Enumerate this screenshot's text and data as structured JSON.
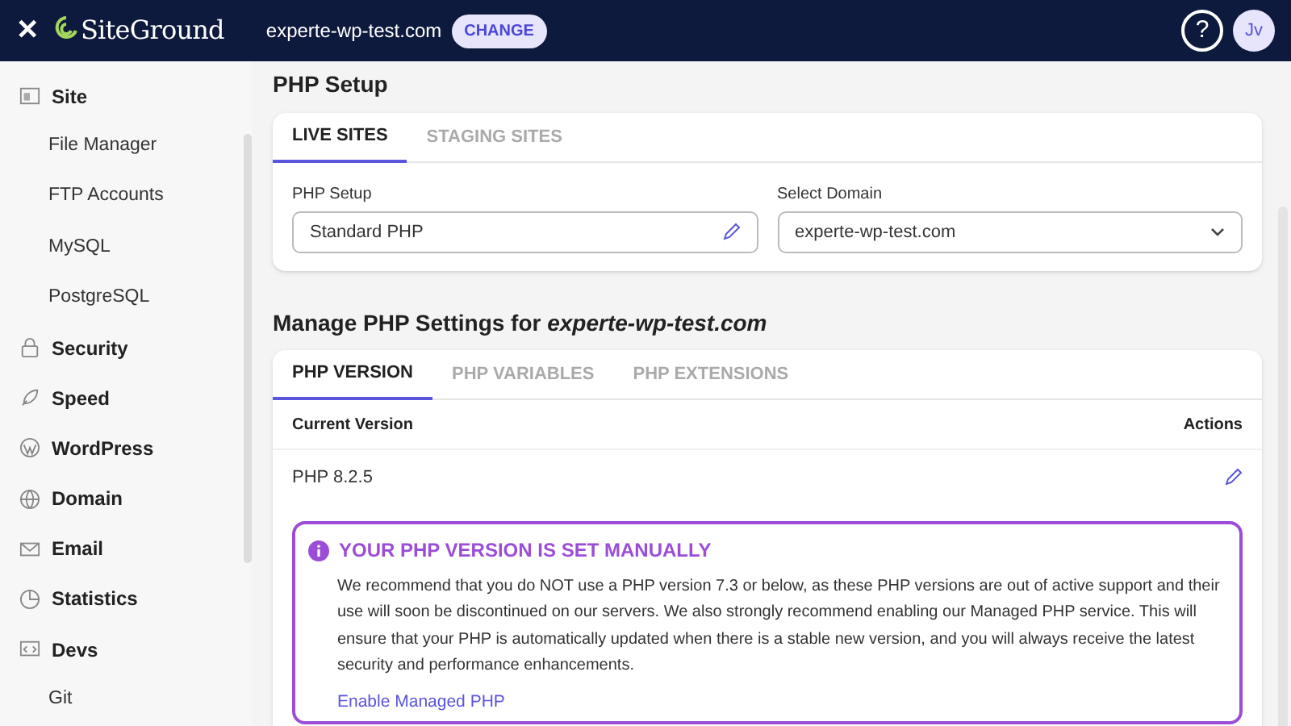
{
  "header": {
    "close": "✕",
    "logo": "SiteGround",
    "site": "experte-wp-test.com",
    "change_button": "CHANGE",
    "help": "?",
    "avatar": "Jv"
  },
  "sidebar": {
    "items": [
      {
        "kind": "section",
        "label": "Site"
      },
      {
        "kind": "sub",
        "label": "File Manager"
      },
      {
        "kind": "sub",
        "label": "FTP Accounts"
      },
      {
        "kind": "sub",
        "label": "MySQL"
      },
      {
        "kind": "sub",
        "label": "PostgreSQL"
      },
      {
        "kind": "section",
        "label": "Security"
      },
      {
        "kind": "section",
        "label": "Speed"
      },
      {
        "kind": "section",
        "label": "WordPress"
      },
      {
        "kind": "section",
        "label": "Domain"
      },
      {
        "kind": "section",
        "label": "Email"
      },
      {
        "kind": "section",
        "label": "Statistics"
      },
      {
        "kind": "section",
        "label": "Devs"
      },
      {
        "kind": "sub",
        "label": "Git"
      }
    ]
  },
  "php_setup": {
    "title": "PHP Setup",
    "tabs": [
      {
        "label": "LIVE SITES",
        "selected": true
      },
      {
        "label": "STAGING SITES",
        "selected": false
      }
    ],
    "setup_label": "PHP Setup",
    "setup_value": "Standard PHP",
    "domain_label": "Select Domain",
    "domain_value": "experte-wp-test.com"
  },
  "manage": {
    "title": "Manage PHP Settings for **experte-wp-test.com**",
    "tabs": [
      {
        "label": "PHP VERSION",
        "selected": true
      },
      {
        "label": "PHP VARIABLES",
        "selected": false
      },
      {
        "label": "PHP EXTENSIONS",
        "selected": false
      }
    ],
    "columns": [
      "Current Version",
      "Actions"
    ],
    "rows": [
      {
        "version": "PHP 8.2.5"
      }
    ],
    "notice": {
      "title": "YOUR PHP VERSION IS SET MANUALLY",
      "text": "We recommend that you do NOT use a PHP version 7.3 or below, as these PHP versions are out of active support and their use will soon be discontinued on our servers. We also strongly recommend enabling our Managed PHP service. This will ensure that your PHP is automatically updated when there is a stable new version, and you will always receive the latest security and performance enhancements.",
      "link": "Enable Managed PHP"
    }
  }
}
